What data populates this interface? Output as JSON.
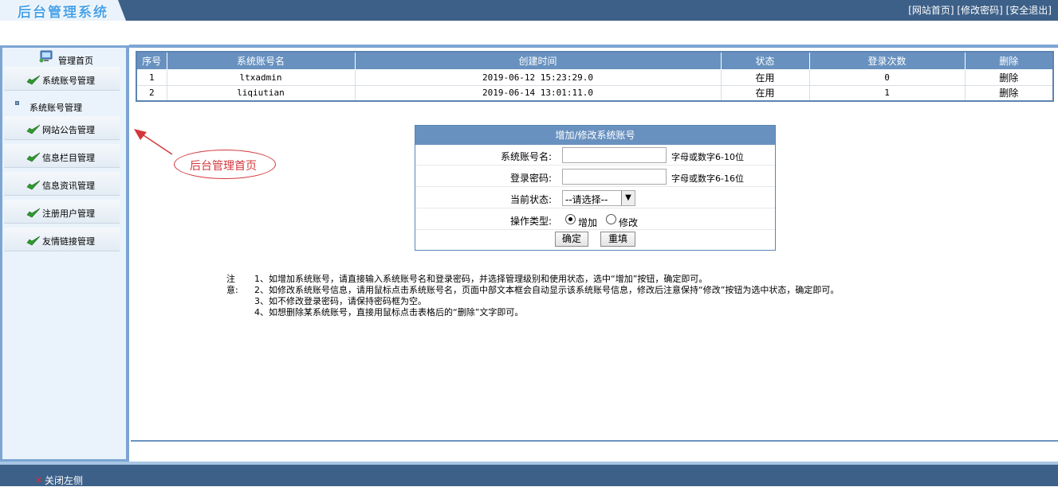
{
  "header": {
    "logo_text": "后台管理系统",
    "links": [
      "[网站首页]",
      "[修改密码]",
      "[安全退出]"
    ]
  },
  "sidebar": {
    "home_label": "管理首页",
    "items": [
      {
        "label": "系统账号管理",
        "icon": "green-arrow-icon"
      },
      {
        "label": "网站公告管理",
        "icon": "green-arrow-icon"
      },
      {
        "label": "信息栏目管理",
        "icon": "green-arrow-icon"
      },
      {
        "label": "信息资讯管理",
        "icon": "green-arrow-icon"
      },
      {
        "label": "注册用户管理",
        "icon": "green-arrow-icon"
      },
      {
        "label": "友情链接管理",
        "icon": "green-arrow-icon"
      }
    ],
    "sub_item": "系统账号管理"
  },
  "table": {
    "columns": [
      "序号",
      "系统账号名",
      "创建时间",
      "状态",
      "登录次数",
      "删除"
    ],
    "rows": [
      [
        "1",
        "ltxadmin",
        "2019-06-12 15:23:29.0",
        "在用",
        "0",
        "删除"
      ],
      [
        "2",
        "liqiutian",
        "2019-06-14 13:01:11.0",
        "在用",
        "1",
        "删除"
      ]
    ]
  },
  "form": {
    "title": "增加/修改系统账号",
    "account_label": "系统账号名:",
    "account_value": "",
    "account_hint": "字母或数字6-10位",
    "password_label": "登录密码:",
    "password_value": "",
    "password_hint": "字母或数字6-16位",
    "status_label": "当前状态:",
    "status_selected": "--请选择--",
    "op_label": "操作类型:",
    "op_add": "增加",
    "op_edit": "修改",
    "op_selected": "增加",
    "confirm": "确定",
    "reset": "重填"
  },
  "annotation": {
    "callout_text": "后台管理首页",
    "color": "#d3373c"
  },
  "notes": {
    "label": "注意:",
    "lines": [
      "1、如增加系统账号，请直接输入系统账号名和登录密码，并选择管理级别和使用状态，选中“增加”按钮，确定即可。",
      "2、如修改系统账号信息，请用鼠标点击系统账号名，页面中部文本框会自动显示该系统账号信息，修改后注意保持“修改”按钮为选中状态，确定即可。",
      "3、如不修改登录密码，请保持密码框为空。",
      "4、如想删除某系统账号，直接用鼠标点击表格后的“删除”文字即可。"
    ]
  },
  "footer": {
    "close_label": "关闭左侧"
  },
  "colors": {
    "header_bg": "#3d6088",
    "table_header": "#6891bf",
    "sidebar_border": "#7ca5d3"
  }
}
